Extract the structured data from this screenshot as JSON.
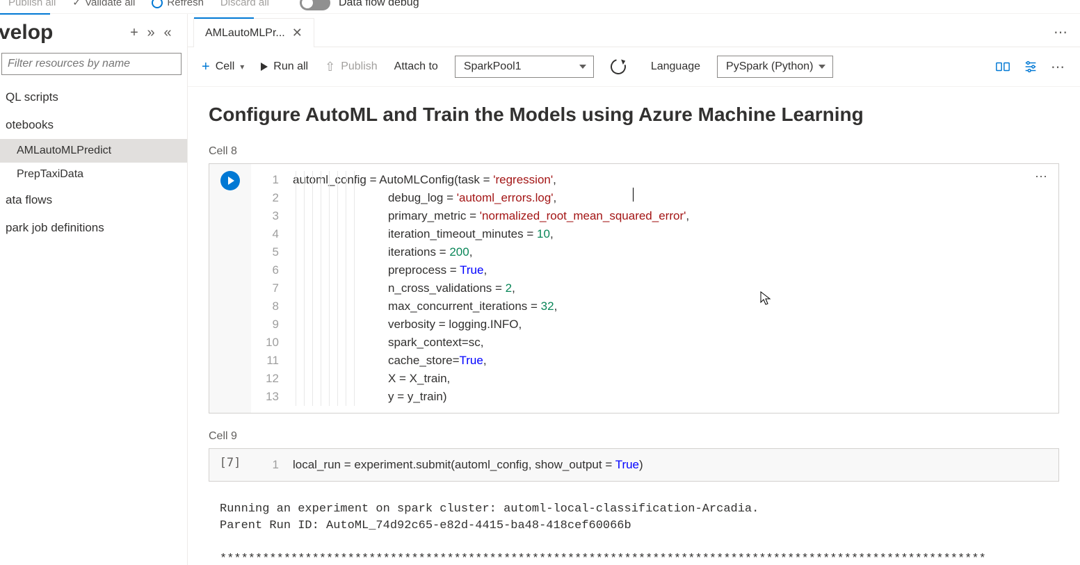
{
  "topBar": {
    "publishAll": "Publish all",
    "validateAll": "Validate all",
    "refresh": "Refresh",
    "discardAll": "Discard all",
    "dataFlowDebug": "Data flow debug"
  },
  "sidebar": {
    "title": "velop",
    "filterPlaceholder": "Filter resources by name",
    "sections": {
      "sql": "QL scripts",
      "notebooks": "otebooks",
      "dataflows": "ata flows",
      "sparkjobs": "park job definitions"
    },
    "notebookItems": [
      "AMLautoMLPredict",
      "PrepTaxiData"
    ]
  },
  "tab": {
    "label": "AMLautoMLPr..."
  },
  "nbToolbar": {
    "cell": "Cell",
    "runAll": "Run all",
    "publish": "Publish",
    "attachTo": "Attach to",
    "pool": "SparkPool1",
    "language": "Language",
    "lang": "PySpark (Python)"
  },
  "notebook": {
    "heading": "Configure AutoML and Train the Models using Azure Machine Learning",
    "cell8Label": "Cell 8",
    "cell9Label": "Cell 9",
    "cell9Exec": "[7]",
    "cell8Lines": [
      {
        "n": "1",
        "pre": "automl_config = AutoMLConfig(task = ",
        "str": "'regression'",
        "post": ","
      },
      {
        "n": "2",
        "pre": "                             debug_log = ",
        "str": "'automl_errors.log'",
        "post": ","
      },
      {
        "n": "3",
        "pre": "                             primary_metric = ",
        "str": "'normalized_root_mean_squared_error'",
        "post": ","
      },
      {
        "n": "4",
        "pre": "                             iteration_timeout_minutes = ",
        "num": "10",
        "post": ","
      },
      {
        "n": "5",
        "pre": "                             iterations = ",
        "num": "200",
        "post": ","
      },
      {
        "n": "6",
        "pre": "                             preprocess = ",
        "kw": "True",
        "post": ","
      },
      {
        "n": "7",
        "pre": "                             n_cross_validations = ",
        "num": "2",
        "post": ","
      },
      {
        "n": "8",
        "pre": "                             max_concurrent_iterations = ",
        "num": "32",
        "post": ","
      },
      {
        "n": "9",
        "pre": "                             verbosity = logging.INFO,",
        "post": ""
      },
      {
        "n": "10",
        "pre": "                             spark_context=sc,",
        "post": ""
      },
      {
        "n": "11",
        "pre": "                             cache_store=",
        "kw": "True",
        "post": ","
      },
      {
        "n": "12",
        "pre": "                             X = X_train,",
        "post": ""
      },
      {
        "n": "13",
        "pre": "                             y = y_train)",
        "post": ""
      }
    ],
    "cell9": {
      "n": "1",
      "pre": "local_run = experiment.submit(automl_config, show_output = ",
      "kw": "True",
      "post": ")"
    },
    "output": "Running an experiment on spark cluster: automl-local-classification-Arcadia.\nParent Run ID: AutoML_74d92c65-e82d-4415-ba48-418cef60066b\n\n************************************************************************************************************"
  }
}
